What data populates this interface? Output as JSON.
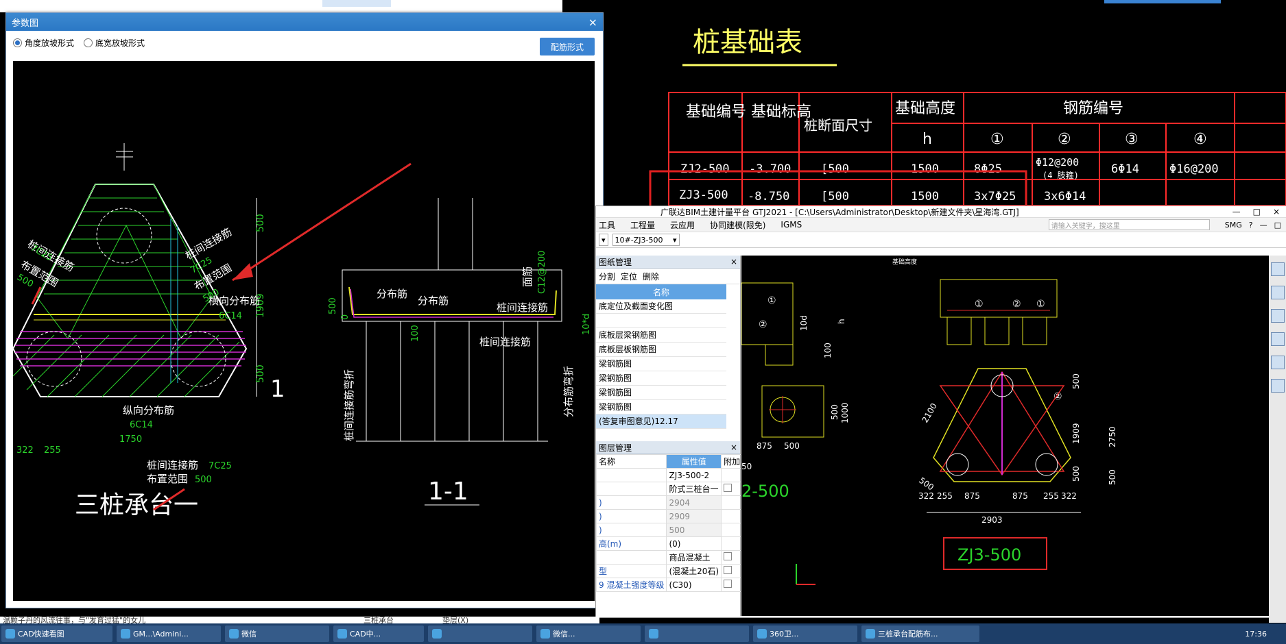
{
  "param_dialog": {
    "title": "参数图",
    "close": "×",
    "option1": "角度放坡形式",
    "option2": "底宽放坡形式",
    "button": "配筋形式",
    "drawing": {
      "labels_left": [
        "桩间连接筋",
        "7C25",
        "布置范围",
        "500",
        "桩间连接筋",
        "7C25",
        "布置范围",
        "500",
        "横向分布筋",
        "6C14",
        "纵向分布筋",
        "6C14",
        "1750",
        "322",
        "255",
        "桩间连接筋",
        "7C25",
        "布置范围",
        "500",
        "1",
        "三桩承台一"
      ],
      "dims_right": [
        "500",
        "1909",
        "500"
      ],
      "section_labels": [
        "分布筋",
        "分布筋",
        "桩间连接筋",
        "桩间连接筋",
        "面筋",
        "C12@200",
        "桩间连接筋弯折",
        "分布筋弯折",
        "10*d",
        "500",
        "0",
        "100",
        "1-1"
      ]
    }
  },
  "cad_bg": {
    "title": "桩基础表",
    "table_headers": [
      "基础编号",
      "基础标高",
      "桩断面尺寸",
      "基础高度",
      "h",
      "钢筋编号",
      "①",
      "②",
      "③",
      "④"
    ],
    "rows": [
      [
        "ZJ2-500",
        "-3.700",
        "[500",
        "1500",
        "8Φ25",
        "Φ12@200",
        "(4 肢箍)",
        "6Φ14",
        "Φ16@200"
      ],
      [
        "ZJ3-500",
        "-8.750",
        "[500",
        "1500",
        "3x7Φ25",
        "3x6Φ14"
      ]
    ]
  },
  "gtj": {
    "title": "广联达BIM土建计量平台 GTJ2021 - [C:\\Users\\Administrator\\Desktop\\新建文件夹\\星海湾.GTJ]",
    "menus": [
      "工具",
      "工程量",
      "云应用",
      "协同建模(限免)",
      "IGMS"
    ],
    "search_placeholder": "请输入关键字，搜这里",
    "right_tools": [
      "SMG",
      "?",
      "—",
      "□"
    ],
    "combo_value": "10#-ZJ3-500",
    "drawing_pane_title": "图纸管理",
    "drawing_tools": [
      "分割",
      "定位",
      "删除"
    ],
    "grid_head": "名称",
    "drawings": [
      "底定位及截面变化图",
      "",
      "底板层梁钢筋图",
      "底板层板钢筋图",
      "梁钢筋图",
      "梁钢筋图",
      "梁钢筋图",
      "梁钢筋图",
      "(答复审图意见)12.17"
    ],
    "layer_pane_title": "图层管理",
    "props_head": [
      "名称",
      "属性值",
      "附加"
    ],
    "props": [
      {
        "n": "",
        "v": "ZJ3-500-2",
        "cb": false
      },
      {
        "n": "",
        "v": "阶式三桩台一",
        "cb": true
      },
      {
        "n": ")",
        "v": "2904",
        "cb": false
      },
      {
        "n": ")",
        "v": "2909",
        "cb": false
      },
      {
        "n": ")",
        "v": "500",
        "cb": false
      },
      {
        "n": "高(m)",
        "v": "(0)",
        "cb": false
      },
      {
        "n": "",
        "v": "商品混凝土",
        "cb": true
      },
      {
        "n": "型",
        "v": "(混凝土20石)",
        "cb": true
      },
      {
        "n": "混凝土强度等级",
        "v": "(C30)",
        "cb": true
      }
    ],
    "row_num": "9",
    "canvas": {
      "label_top": "基础高度",
      "part": "ZJ3-500",
      "part_left": "2-500",
      "dims_bottom": [
        "322",
        "255",
        "875",
        "875",
        "255",
        "322"
      ],
      "dims_total": "2903",
      "dims_side": [
        "500",
        "1909",
        "500",
        "2750",
        "500"
      ],
      "diag": [
        "2100",
        "500"
      ],
      "small_dims": [
        "875",
        "500",
        "500",
        "1000",
        "100",
        "10d",
        "h",
        "50"
      ],
      "circles": [
        "①",
        "②",
        "①",
        "②",
        "①",
        "②"
      ]
    }
  },
  "taskbar": {
    "items": [
      "CAD快速看图",
      "GM...\\Admini...",
      "微信",
      "CAD中...",
      "",
      "微信...",
      "",
      "360卫...",
      "三桩承台配筋布..."
    ],
    "clock": "17:36"
  },
  "bottom_note": "温颗子丹的风流往事，与\"发育过猛\"的女儿",
  "bottom_small": [
    "三桩承台",
    "垫层(X)"
  ]
}
